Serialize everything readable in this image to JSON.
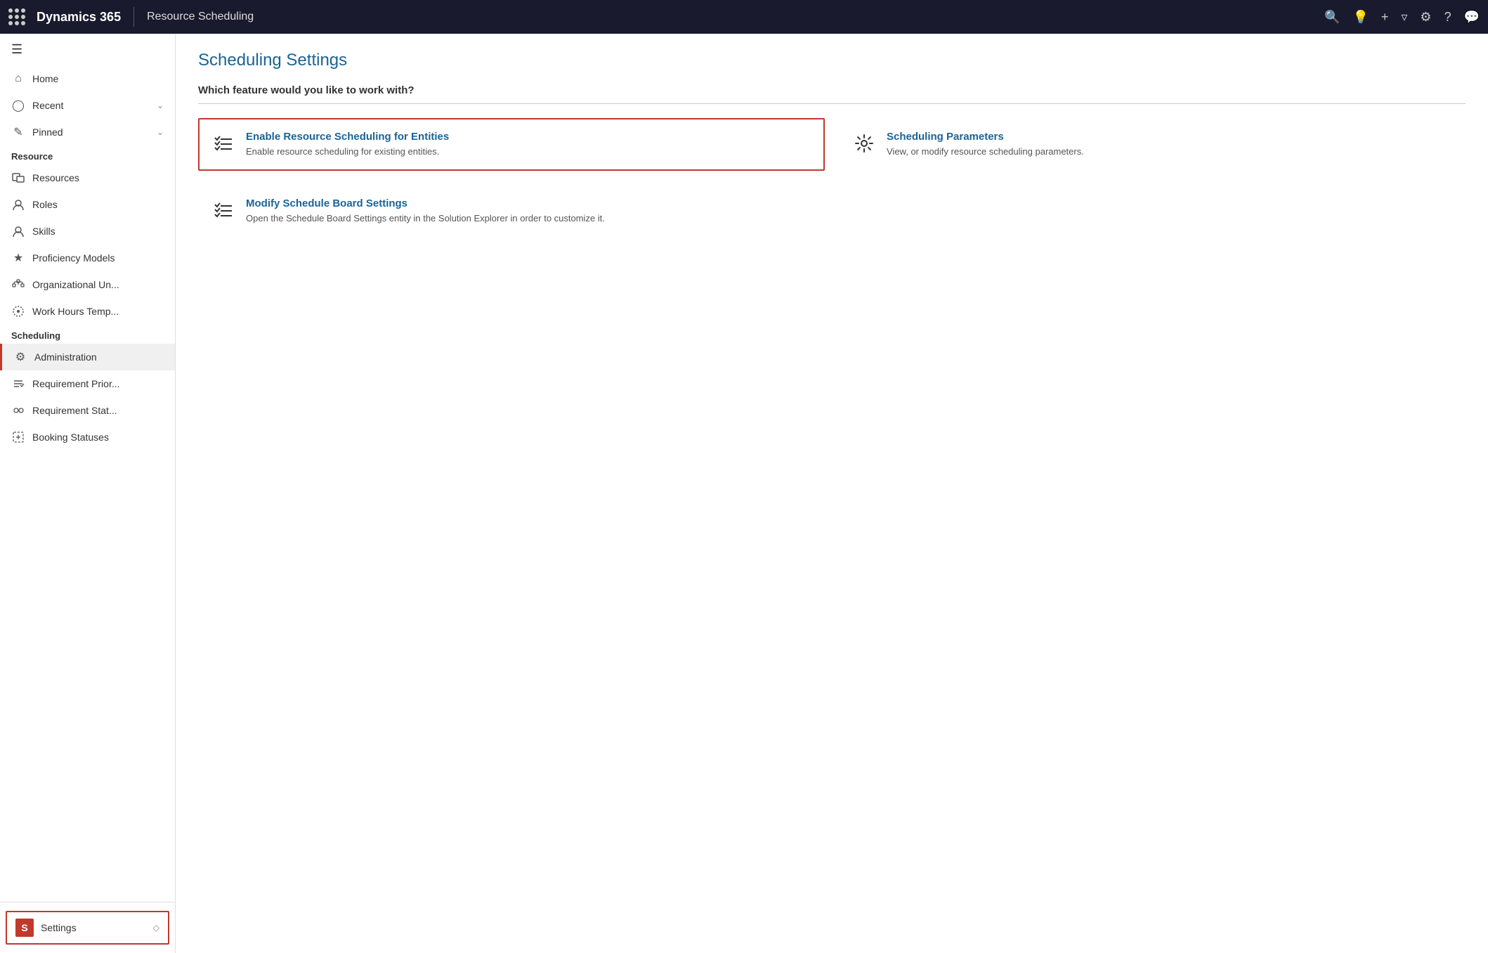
{
  "topNav": {
    "brand": "Dynamics 365",
    "module": "Resource Scheduling",
    "icons": [
      "search",
      "lightbulb",
      "plus",
      "filter",
      "gear",
      "question",
      "comment"
    ]
  },
  "sidebar": {
    "sections": [
      {
        "label": "",
        "items": [
          {
            "id": "home",
            "label": "Home",
            "icon": "⌂",
            "hasChevron": false
          },
          {
            "id": "recent",
            "label": "Recent",
            "icon": "◷",
            "hasChevron": true
          },
          {
            "id": "pinned",
            "label": "Pinned",
            "icon": "☆",
            "hasChevron": true
          }
        ]
      },
      {
        "label": "Resource",
        "items": [
          {
            "id": "resources",
            "label": "Resources",
            "icon": "👤",
            "hasChevron": false
          },
          {
            "id": "roles",
            "label": "Roles",
            "icon": "👤",
            "hasChevron": false
          },
          {
            "id": "skills",
            "label": "Skills",
            "icon": "👤",
            "hasChevron": false
          },
          {
            "id": "proficiency",
            "label": "Proficiency Models",
            "icon": "★",
            "hasChevron": false
          },
          {
            "id": "org-units",
            "label": "Organizational Un...",
            "icon": "⬡",
            "hasChevron": false
          },
          {
            "id": "work-hours",
            "label": "Work Hours Temp...",
            "icon": "⊙",
            "hasChevron": false
          }
        ]
      },
      {
        "label": "Scheduling",
        "items": [
          {
            "id": "administration",
            "label": "Administration",
            "icon": "⚙",
            "hasChevron": false,
            "active": true
          },
          {
            "id": "req-priorities",
            "label": "Requirement Prior...",
            "icon": "↕",
            "hasChevron": false
          },
          {
            "id": "req-statuses",
            "label": "Requirement Stat...",
            "icon": "👥",
            "hasChevron": false
          },
          {
            "id": "booking-statuses",
            "label": "Booking Statuses",
            "icon": "⚑",
            "hasChevron": false
          }
        ]
      }
    ],
    "settingsItem": {
      "label": "Settings",
      "badge": "S"
    }
  },
  "main": {
    "pageTitle": "Scheduling Settings",
    "sectionQuestion": "Which feature would you like to work with?",
    "cards": [
      {
        "id": "enable-resource-scheduling",
        "title": "Enable Resource Scheduling for Entities",
        "desc": "Enable resource scheduling for existing entities.",
        "iconType": "checklist",
        "selected": true
      },
      {
        "id": "scheduling-parameters",
        "title": "Scheduling Parameters",
        "desc": "View, or modify resource scheduling parameters.",
        "iconType": "gear",
        "selected": false
      },
      {
        "id": "modify-schedule-board",
        "title": "Modify Schedule Board Settings",
        "desc": "Open the Schedule Board Settings entity in the Solution Explorer in order to customize it.",
        "iconType": "checklist",
        "selected": false
      }
    ]
  }
}
